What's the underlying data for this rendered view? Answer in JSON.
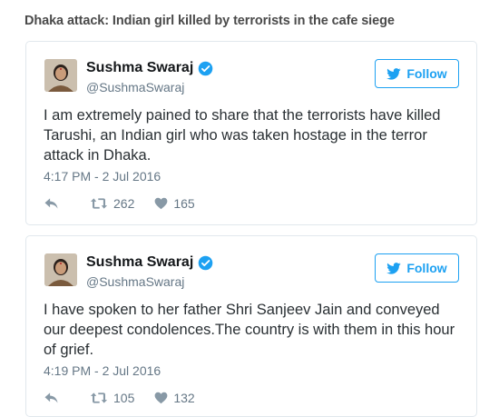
{
  "headline": "Dhaka attack: Indian girl killed by terrorists in the cafe siege",
  "colors": {
    "twitter_blue": "#1da1f2",
    "muted": "#657786",
    "border": "#e1e8ed"
  },
  "tweets": [
    {
      "author": "Sushma Swaraj",
      "handle": "@SushmaSwaraj",
      "follow_label": "Follow",
      "text": "I am extremely pained to share that the terrorists have killed Tarushi, an Indian girl who was taken hostage in the terror attack in Dhaka.",
      "timestamp": "4:17 PM - 2 Jul 2016",
      "retweets": "262",
      "likes": "165"
    },
    {
      "author": "Sushma Swaraj",
      "handle": "@SushmaSwaraj",
      "follow_label": "Follow",
      "text": "I have spoken to her father Shri Sanjeev Jain and conveyed our deepest condolences.The country is with them in this hour of grief.",
      "timestamp": "4:19 PM - 2 Jul 2016",
      "retweets": "105",
      "likes": "132"
    }
  ]
}
